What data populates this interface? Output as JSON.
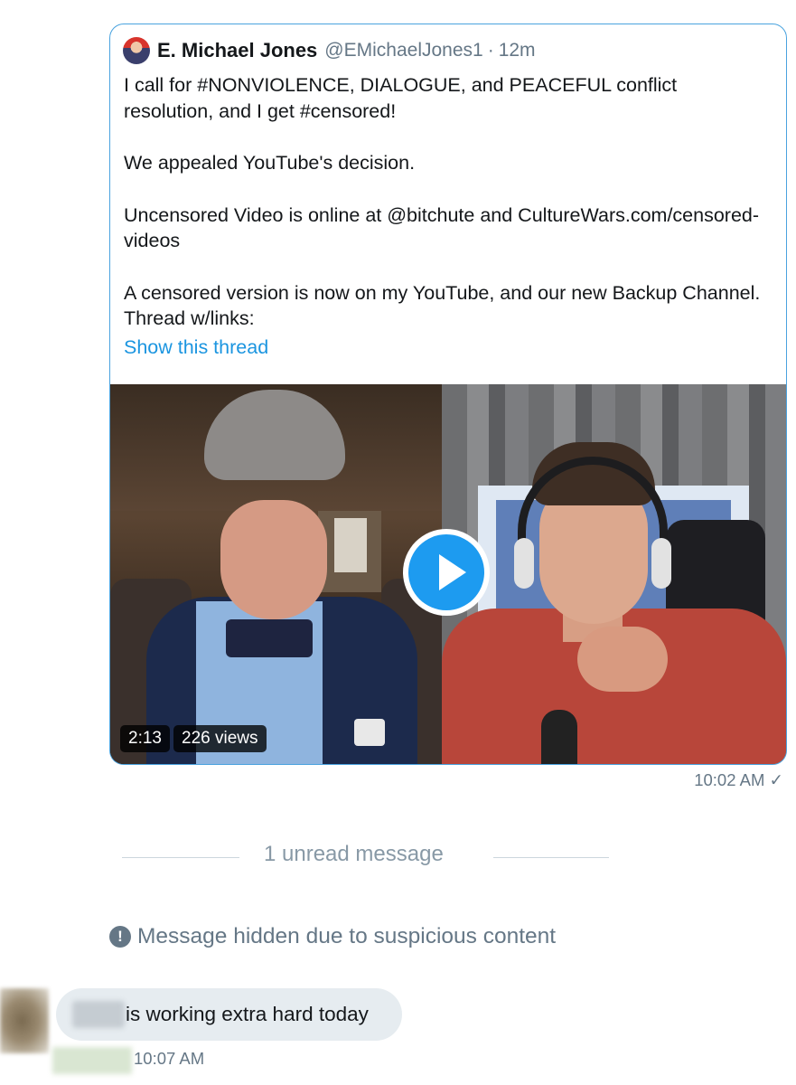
{
  "tweet": {
    "author_name": "E. Michael Jones",
    "author_handle": "@EMichaelJones1",
    "separator": "·",
    "time_ago": "12m",
    "paragraphs": [
      "I call for #NONVIOLENCE, DIALOGUE, and PEACEFUL conflict resolution, and I get #censored!",
      "We appealed YouTube's decision.",
      "Uncensored Video is online at @bitchute and CultureWars.com/censored-videos",
      "A censored version is now on my YouTube, and our new Backup Channel. Thread w/links:"
    ],
    "show_thread": "Show this thread",
    "video": {
      "duration": "2:13",
      "views": "226 views",
      "play_icon": "play-icon"
    }
  },
  "sent_message": {
    "time": "10:02 AM ✓"
  },
  "divider": {
    "unread_label": "1 unread message"
  },
  "hidden_notice": {
    "icon": "exclamation-circle-icon",
    "text": "Message hidden due to suspicious content"
  },
  "received_message": {
    "text": "is working extra hard today",
    "time": "10:07 AM"
  },
  "colors": {
    "accent": "#1d9bf0",
    "card_border": "#4aa3df",
    "link": "#1b95e0",
    "muted_text": "#657786",
    "bubble_bg": "#e6ecf0"
  }
}
